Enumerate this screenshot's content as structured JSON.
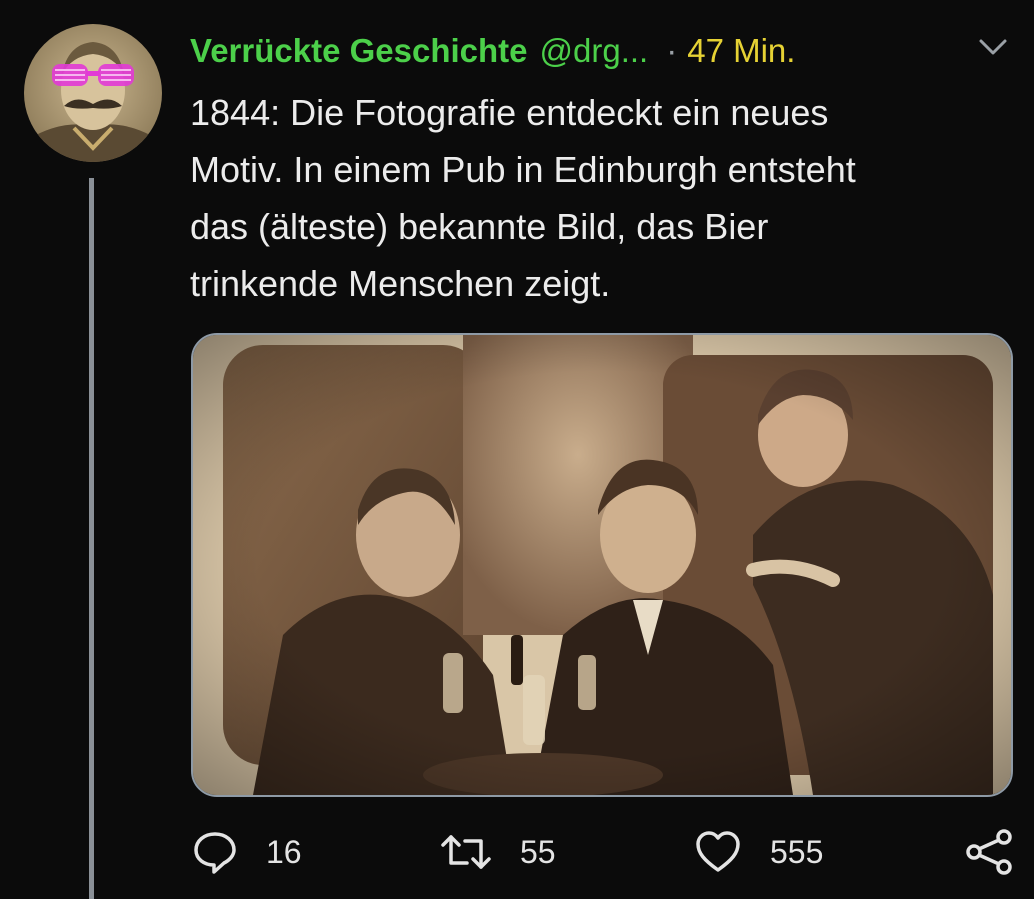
{
  "tweet": {
    "display_name": "Verrückte Geschichte",
    "handle": "@drg...",
    "separator": "·",
    "time": "47 Min.",
    "text_lines": [
      "1844: Die Fotografie entdeckt ein neues",
      "Motiv. In einem Pub in Edinburgh entsteht",
      "das (älteste) bekannte Bild, das Bier",
      "trinkende Menschen zeigt."
    ],
    "media": {
      "kind": "sepia-photograph",
      "subject": "three-men-drinking-beer"
    }
  },
  "actions": {
    "reply_count": "16",
    "retweet_count": "55",
    "like_count": "555"
  },
  "icons": {
    "reply": "speech-bubble-icon",
    "retweet": "retweet-arrows-icon",
    "like": "heart-icon",
    "share": "share-icon",
    "menu": "chevron-down-icon"
  },
  "colors": {
    "background": "#0b0b0b",
    "name": "#4cd04a",
    "time": "#e6d234",
    "text": "#ececec",
    "meta": "#9aa0a6",
    "glasses": "#e23ad6"
  }
}
